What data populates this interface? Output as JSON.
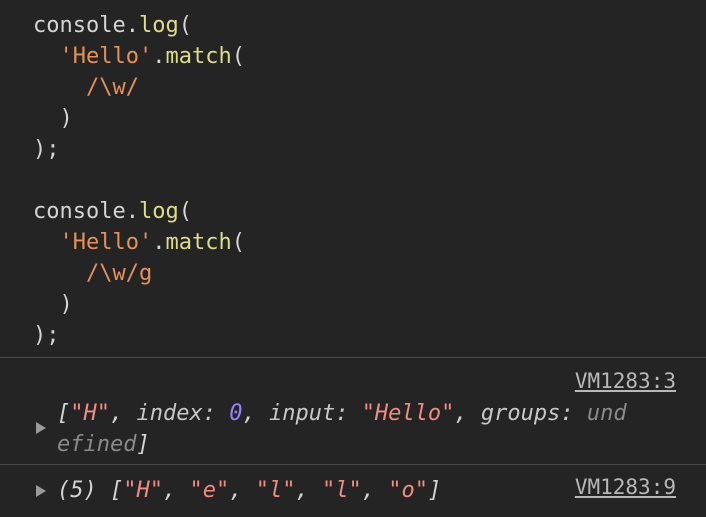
{
  "code": {
    "block1": {
      "line1_obj": "console",
      "line1_dot": ".",
      "line1_method": "log",
      "line1_paren": "(",
      "line2_str": "'Hello'",
      "line2_dot": ".",
      "line2_method": "match",
      "line2_paren": "(",
      "line3_regex": "/\\w/",
      "line4_close": ")",
      "line5_close": ");"
    },
    "block2": {
      "line1_obj": "console",
      "line1_dot": ".",
      "line1_method": "log",
      "line1_paren": "(",
      "line2_str": "'Hello'",
      "line2_dot": ".",
      "line2_method": "match",
      "line2_paren": "(",
      "line3_regex": "/\\w/g",
      "line4_close": ")",
      "line5_close": ");"
    }
  },
  "console": {
    "entry1": {
      "source": "VM1283:3",
      "open_bracket": "[",
      "match_value": "\"H\"",
      "sep1": ", ",
      "index_key": "index: ",
      "index_value": "0",
      "sep2": ", ",
      "input_key": "input: ",
      "input_value": "\"Hello\"",
      "sep3": ", ",
      "groups_key": "groups: ",
      "groups_value_part1": "und",
      "groups_value_part2": "efined",
      "close_bracket": "]"
    },
    "entry2": {
      "source": "VM1283:9",
      "count": "(5) ",
      "open_bracket": "[",
      "items": [
        "\"H\"",
        "\"e\"",
        "\"l\"",
        "\"l\"",
        "\"o\""
      ],
      "sep": ", ",
      "close_bracket": "]"
    }
  },
  "colors": {
    "background": "#242424",
    "string": "#f28b82",
    "number": "#9980ff",
    "method": "#dcdc8b",
    "code_string": "#e6905a"
  }
}
